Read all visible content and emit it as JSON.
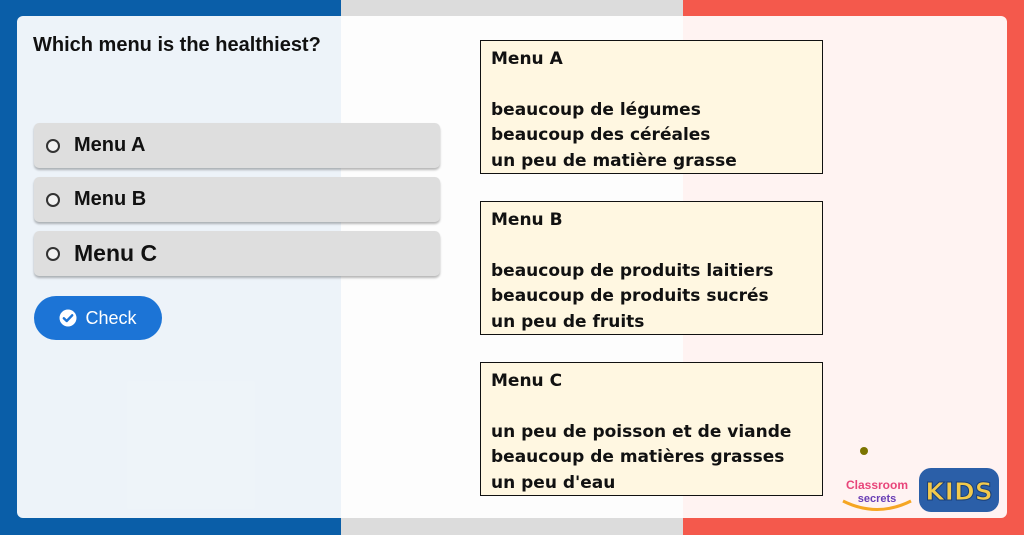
{
  "question": "Which menu is the healthiest?",
  "options": [
    {
      "label": "Menu A"
    },
    {
      "label": "Menu B"
    },
    {
      "label": "Menu C"
    }
  ],
  "check_button": {
    "label": "Check"
  },
  "menus": [
    {
      "title": "Menu A",
      "lines": [
        "beaucoup de légumes",
        "beaucoup des céréales",
        "un peu de matière grasse"
      ]
    },
    {
      "title": "Menu B",
      "lines": [
        "beaucoup de produits laitiers",
        "beaucoup de produits sucrés",
        "un peu de fruits"
      ]
    },
    {
      "title": "Menu C",
      "lines": [
        "un peu de poisson et de viande",
        "beaucoup de matières grasses",
        "un peu d'eau"
      ]
    }
  ],
  "logos": {
    "classroom_line1": "Classroom",
    "classroom_line2": "secrets",
    "kids": "KIDS"
  },
  "colors": {
    "flag_blue": "#0a5ea8",
    "flag_white": "#dcdcdc",
    "flag_red": "#f4594c",
    "check_button": "#1c74d6",
    "menu_box_bg": "#fff7e1"
  }
}
